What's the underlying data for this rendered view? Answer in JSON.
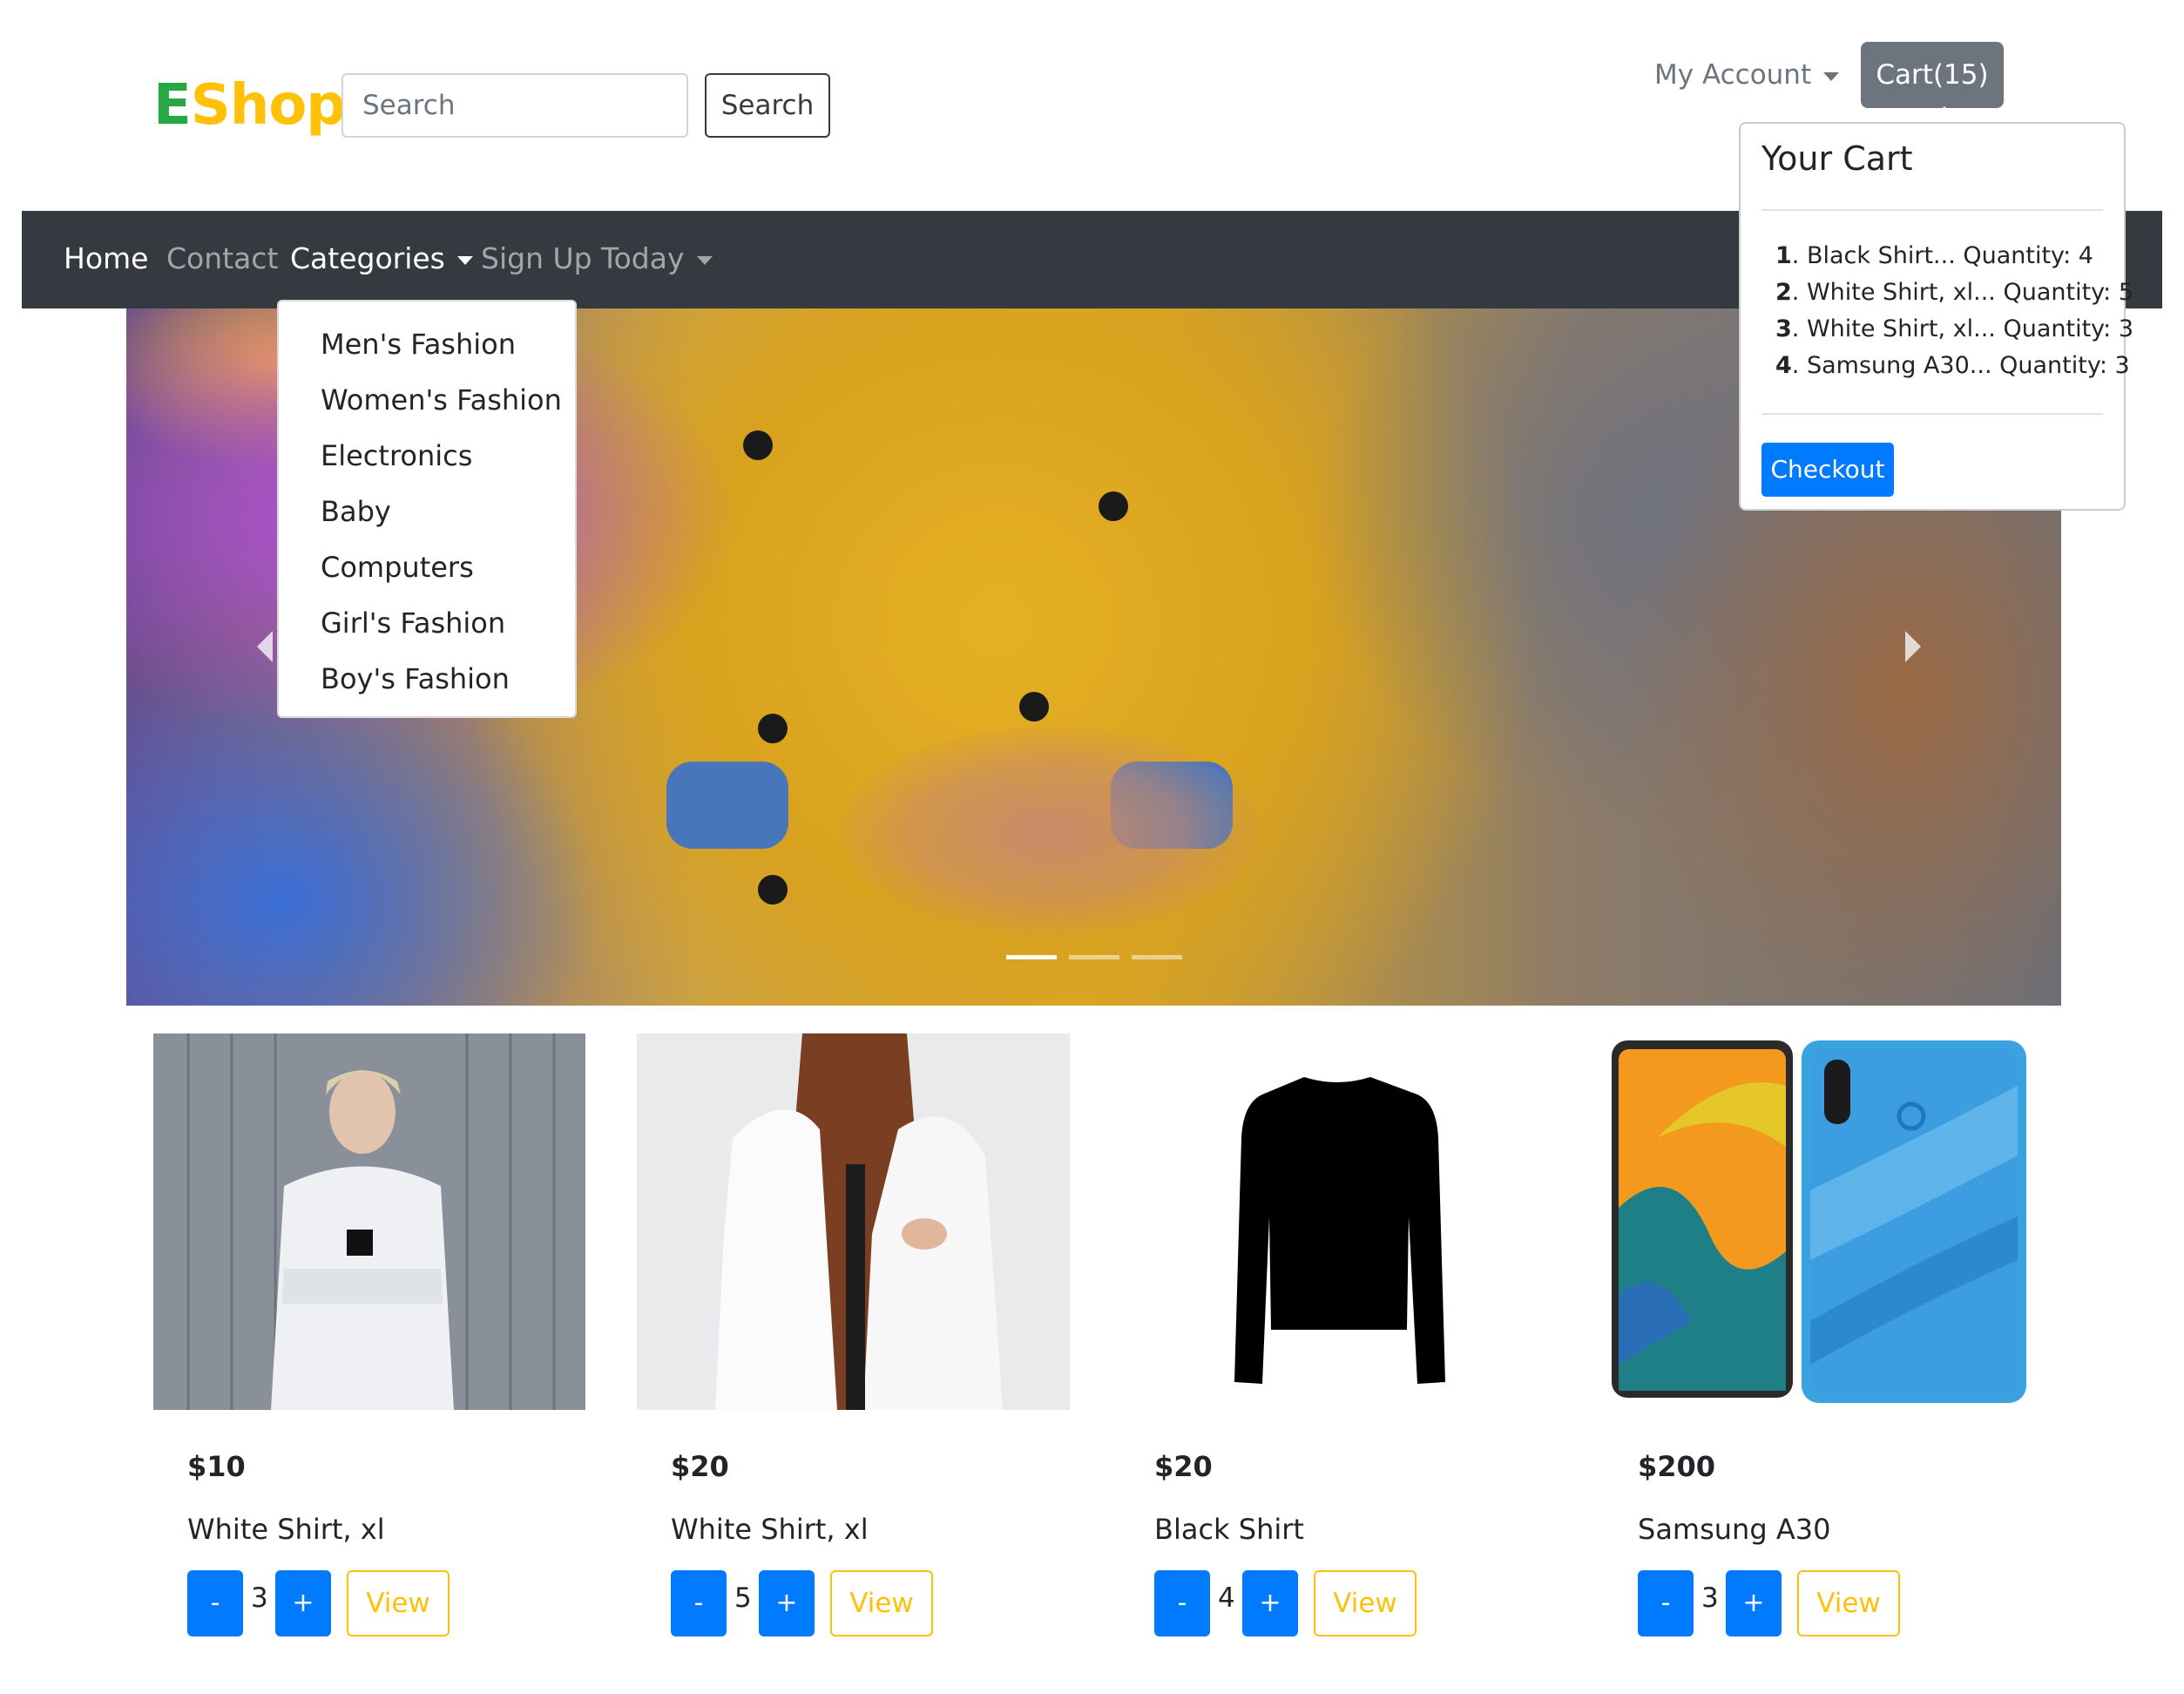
{
  "header": {
    "logo_first": "E",
    "logo_rest": "Shop",
    "search_placeholder": "Search",
    "search_button": "Search",
    "my_account": "My Account",
    "cart_button": "Cart(15)"
  },
  "navbar": {
    "items": [
      "Home",
      "Contact",
      "Categories",
      "Sign Up Today"
    ]
  },
  "categories_dropdown": [
    "Men's Fashion",
    "Women's Fashion",
    "Electronics",
    "Baby",
    "Computers",
    "Girl's Fashion",
    "Boy's Fashion"
  ],
  "cart_popover": {
    "title": "Your Cart",
    "items": [
      {
        "num": "1",
        "text": ". Black Shirt... Quantity: 4"
      },
      {
        "num": "2",
        "text": ". White Shirt, xl... Quantity: 5"
      },
      {
        "num": "3",
        "text": ". White Shirt, xl... Quantity: 3"
      },
      {
        "num": "4",
        "text": ". Samsung A30... Quantity: 3"
      }
    ],
    "checkout": "Checkout"
  },
  "carousel": {
    "slides_count": 3,
    "active_slide": 1
  },
  "products": [
    {
      "price": "$10",
      "name": "White Shirt, xl",
      "quantity": "3",
      "minus": "-",
      "plus": "+",
      "view": "View"
    },
    {
      "price": "$20",
      "name": "White Shirt, xl",
      "quantity": "5",
      "minus": "-",
      "plus": "+",
      "view": "View"
    },
    {
      "price": "$20",
      "name": "Black Shirt",
      "quantity": "4",
      "minus": "-",
      "plus": "+",
      "view": "View"
    },
    {
      "price": "$200",
      "name": "Samsung A30",
      "quantity": "3",
      "minus": "-",
      "plus": "+",
      "view": "View"
    }
  ],
  "colors": {
    "primary": "#007bff",
    "warning": "#ffc107",
    "success": "#28a745",
    "dark": "#343a40",
    "secondary": "#6c757d"
  }
}
